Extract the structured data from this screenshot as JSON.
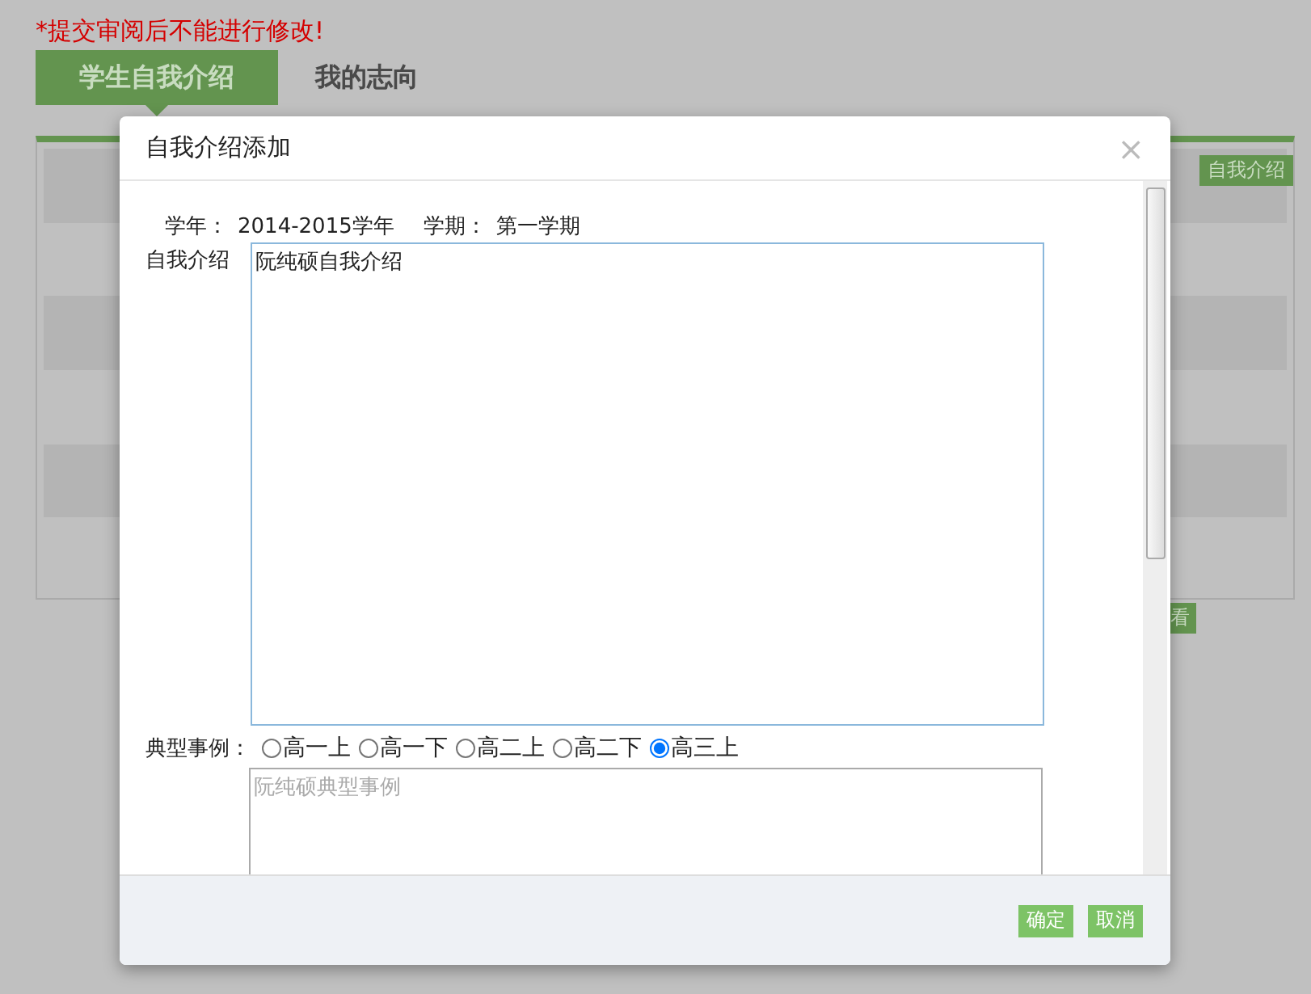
{
  "notice": "*提交审阅后不能进行修改!",
  "tabs": [
    {
      "label": "学生自我介绍",
      "selected": true
    },
    {
      "label": "我的志向",
      "selected": false
    }
  ],
  "background": {
    "add_button": "自我介绍",
    "row_button": "看"
  },
  "dialog": {
    "title": "自我介绍添加",
    "close": "×",
    "school_year_label": "学年：",
    "school_year": "2014-2015学年",
    "term_label": "学期：",
    "term": "第一学期",
    "intro_label": "自我介绍",
    "intro_value": "阮纯硕自我介绍",
    "cases_label": "典型事例：",
    "grades": [
      {
        "label": "高一上",
        "selected": false
      },
      {
        "label": "高一下",
        "selected": false
      },
      {
        "label": "高二上",
        "selected": false
      },
      {
        "label": "高二下",
        "selected": false
      },
      {
        "label": "高三上",
        "selected": true
      }
    ],
    "cases_placeholder": "阮纯硕典型事例",
    "buttons": [
      "确定",
      "取消"
    ]
  }
}
